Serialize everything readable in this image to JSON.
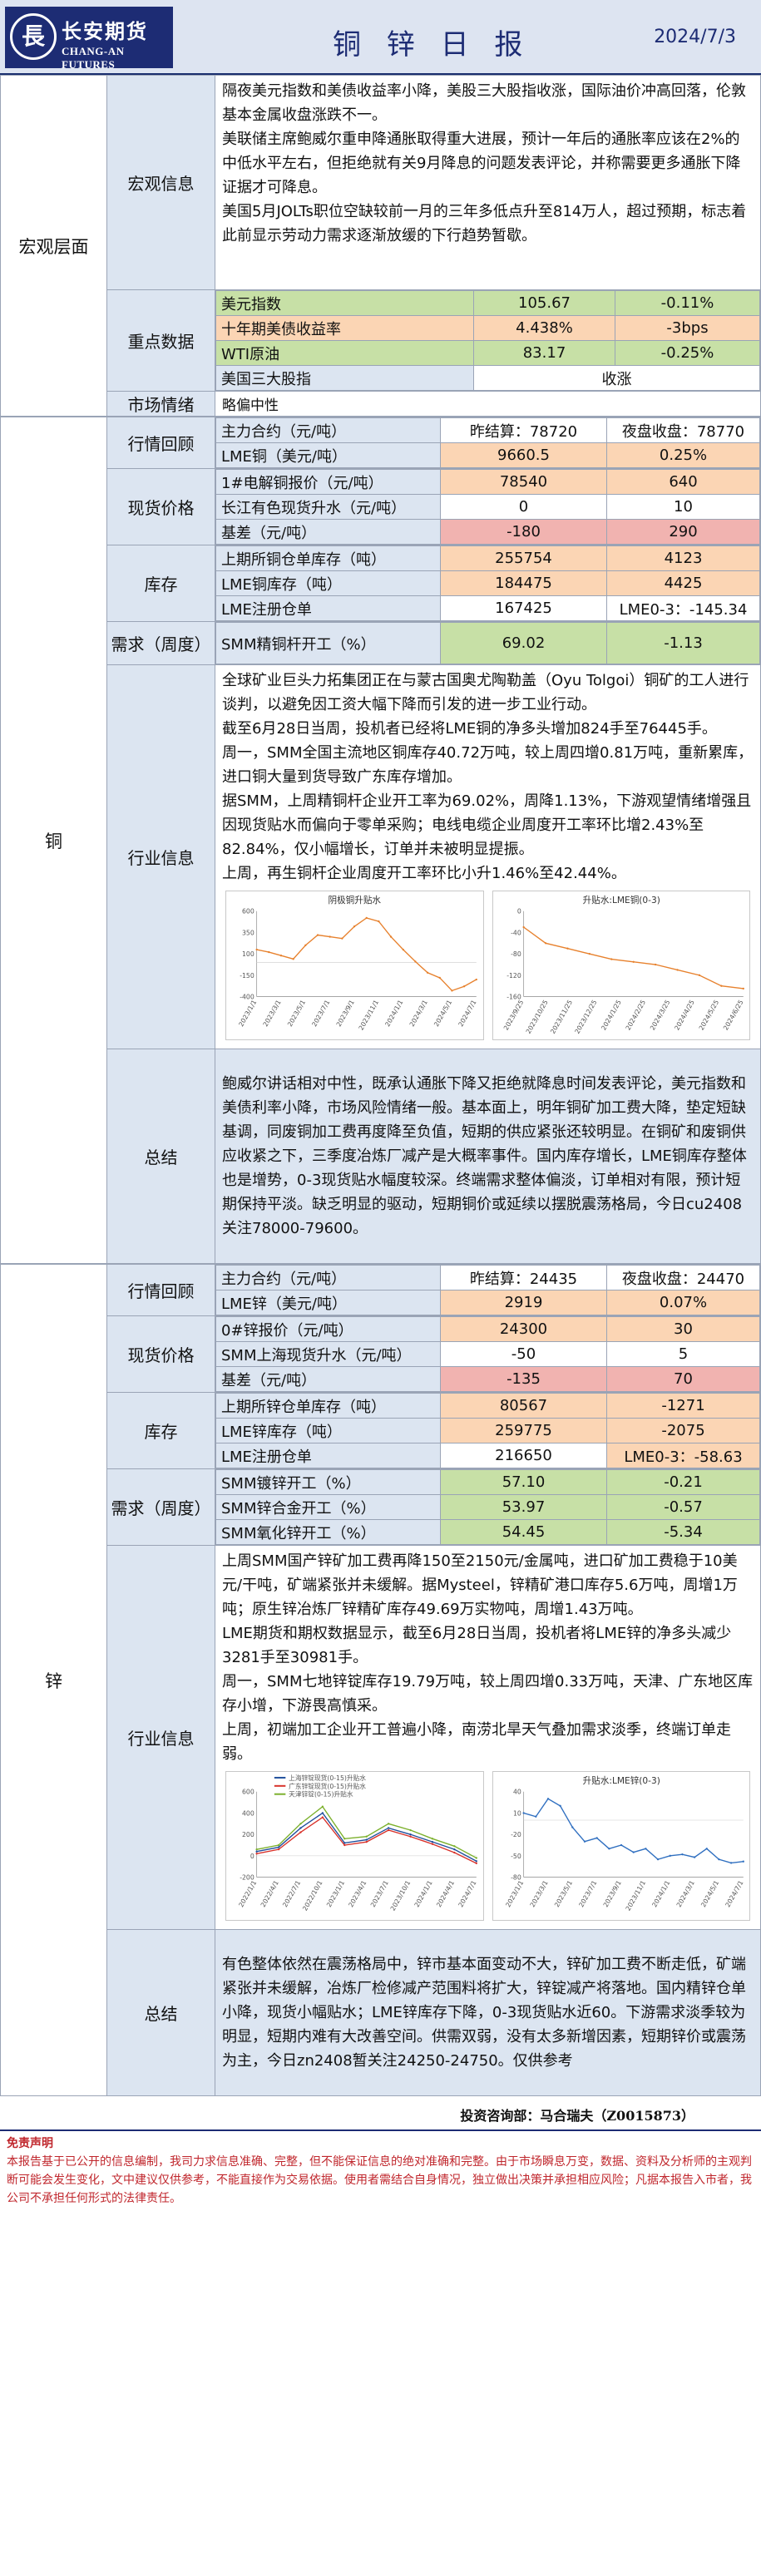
{
  "header": {
    "logo_cn": "长安期货",
    "logo_en": "CHANG-AN FUTURES",
    "title": "铜 锌 日 报",
    "date": "2024/7/3"
  },
  "macro": {
    "section": "宏观层面",
    "info_label": "宏观信息",
    "info_paragraphs": [
      "隔夜美元指数和美债收益率小降，美股三大股指收涨，国际油价冲高回落，伦敦基本金属收盘涨跌不一。",
      "美联储主席鲍威尔重申降通胀取得重大进展，预计一年后的通胀率应该在2%的中低水平左右，但拒绝就有关9月降息的问题发表评论，并称需要更多通胀下降证据才可降息。",
      "美国5月JOLTs职位空缺较前一月的三年多低点升至814万人，超过预期，标志着此前显示劳动力需求逐渐放缓的下行趋势暂歇。"
    ],
    "key_label": "重点数据",
    "key_rows": [
      {
        "name": "美元指数",
        "value": "105.67",
        "change": "-0.11%"
      },
      {
        "name": "十年期美债收益率",
        "value": "4.438%",
        "change": "-3bps"
      },
      {
        "name": "WTI原油",
        "value": "83.17",
        "change": "-0.25%"
      },
      {
        "name": "美国三大股指",
        "value": "",
        "change": "收涨"
      }
    ],
    "mood_label": "市场情绪",
    "mood_value": "略偏中性"
  },
  "copper": {
    "section": "铜",
    "review_label": "行情回顾",
    "main_contract": "主力合约（元/吨）",
    "settle": "昨结算：78720",
    "night": "夜盘收盘：78770",
    "lme_name": "LME铜（美元/吨）",
    "lme_value": "9660.5",
    "lme_change": "0.25%",
    "spot_label": "现货价格",
    "spot_rows": [
      {
        "name": "1#电解铜报价（元/吨）",
        "value": "78540",
        "change": "640"
      },
      {
        "name": "长江有色现货升水（元/吨）",
        "value": "0",
        "change": "10"
      },
      {
        "name": "基差（元/吨）",
        "value": "-180",
        "change": "290"
      }
    ],
    "inv_label": "库存",
    "inv_rows": [
      {
        "name": "上期所铜仓单库存（吨）",
        "value": "255754",
        "change": "4123"
      },
      {
        "name": "LME铜库存（吨）",
        "value": "184475",
        "change": "4425"
      },
      {
        "name": "LME注册仓单",
        "value": "167425",
        "change": "LME0-3：-145.34"
      }
    ],
    "demand_label": "需求（周度）",
    "demand_rows": [
      {
        "name": "SMM精铜杆开工（%）",
        "value": "69.02",
        "change": "-1.13"
      }
    ],
    "industry_label": "行业信息",
    "industry_paragraphs": [
      "全球矿业巨头力拓集团正在与蒙古国奥尤陶勒盖（Oyu Tolgoi）铜矿的工人进行谈判，以避免因工资大幅下降而引发的进一步工业行动。",
      "截至6月28日当周，投机者已经将LME铜的净多头增加824手至76445手。",
      "周一，SMM全国主流地区铜库存40.72万吨，较上周四增0.81万吨，重新累库，进口铜大量到货导致广东库存增加。",
      "据SMM，上周精铜杆企业开工率为69.02%，周降1.13%，下游观望情绪增强且因现货贴水而偏向于零单采购；电线电缆企业周度开工率环比增2.43%至82.84%，仅小幅增长，订单并未被明显提振。",
      "上周，再生铜杆企业周度开工率环比小升1.46%至42.44%。"
    ],
    "chart_data": [
      {
        "type": "line",
        "title": "阴极铜升贴水",
        "x": [
          "2023/1/1",
          "2023/2/1",
          "2023/3/1",
          "2023/4/1",
          "2023/5/1",
          "2023/6/1",
          "2023/7/1",
          "2023/8/1",
          "2023/9/1",
          "2023/10/1",
          "2023/11/1",
          "2023/12/1",
          "2024/1/1",
          "2024/2/1",
          "2024/3/1",
          "2024/4/1",
          "2024/5/1",
          "2024/6/1",
          "2024/7/1"
        ],
        "x_ticks": [
          "2023/1/1",
          "2023/3/1",
          "2023/5/1",
          "2023/7/1",
          "2023/9/1",
          "2023/11/1",
          "2024/1/1",
          "2024/3/1",
          "2024/5/1",
          "2024/7/1"
        ],
        "values": [
          150,
          120,
          80,
          40,
          200,
          320,
          300,
          280,
          420,
          520,
          480,
          300,
          150,
          10,
          -120,
          -180,
          -330,
          -280,
          -200
        ],
        "ylim": [
          -400,
          600
        ],
        "color": "#e7812d"
      },
      {
        "type": "line",
        "title": "升贴水:LME铜(0-3)",
        "x": [
          "2023/9/1",
          "2023/10/1",
          "2023/11/1",
          "2023/12/1",
          "2024/1/1",
          "2024/2/1",
          "2024/3/1",
          "2024/4/1",
          "2024/5/1",
          "2024/6/1",
          "2024/7/1"
        ],
        "x_ticks": [
          "2023/9/25",
          "2023/10/25",
          "2023/11/25",
          "2023/12/25",
          "2024/1/25",
          "2024/2/25",
          "2024/3/25",
          "2024/4/25",
          "2024/5/25",
          "2024/6/25"
        ],
        "values": [
          -30,
          -60,
          -70,
          -80,
          -90,
          -95,
          -100,
          -110,
          -120,
          -140,
          -145
        ],
        "ylim": [
          -160,
          0
        ],
        "color": "#e7812d"
      }
    ],
    "summary_label": "总结",
    "summary": "鲍威尔讲话相对中性，既承认通胀下降又拒绝就降息时间发表评论，美元指数和美债利率小降，市场风险情绪一般。基本面上，明年铜矿加工费大降，垫定短缺基调，同废铜加工费再度降至负值，短期的供应紧张还较明显。在铜矿和废铜供应收紧之下，三季度冶炼厂减产是大概率事件。国内库存增长，LME铜库存整体也是增势，0-3现货贴水幅度较深。终端需求整体偏淡，订单相对有限，预计短期保持平淡。缺乏明显的驱动，短期铜价或延续以摆脱震荡格局，今日cu2408关注78000-79600。"
  },
  "zinc": {
    "section": "锌",
    "review_label": "行情回顾",
    "main_contract": "主力合约（元/吨）",
    "settle": "昨结算：24435",
    "night": "夜盘收盘：24470",
    "lme_name": "LME锌（美元/吨）",
    "lme_value": "2919",
    "lme_change": "0.07%",
    "spot_label": "现货价格",
    "spot_rows": [
      {
        "name": "0#锌报价（元/吨）",
        "value": "24300",
        "change": "30"
      },
      {
        "name": "SMM上海现货升水（元/吨）",
        "value": "-50",
        "change": "5"
      },
      {
        "name": "基差（元/吨）",
        "value": "-135",
        "change": "70"
      }
    ],
    "inv_label": "库存",
    "inv_rows": [
      {
        "name": "上期所锌仓单库存（吨）",
        "value": "80567",
        "change": "-1271"
      },
      {
        "name": "LME锌库存（吨）",
        "value": "259775",
        "change": "-2075"
      },
      {
        "name": "LME注册仓单",
        "value": "216650",
        "change": "LME0-3：-58.63"
      }
    ],
    "demand_label": "需求（周度）",
    "demand_rows": [
      {
        "name": "SMM镀锌开工（%）",
        "value": "57.10",
        "change": "-0.21"
      },
      {
        "name": "SMM锌合金开工（%）",
        "value": "53.97",
        "change": "-0.57"
      },
      {
        "name": "SMM氧化锌开工（%）",
        "value": "54.45",
        "change": "-5.34"
      }
    ],
    "industry_label": "行业信息",
    "industry_paragraphs": [
      "上周SMM国产锌矿加工费再降150至2150元/金属吨，进口矿加工费稳于10美元/干吨，矿端紧张并未缓解。据Mysteel，锌精矿港口库存5.6万吨，周增1万吨；原生锌冶炼厂锌精矿库存49.69万实物吨，周增1.43万吨。",
      "LME期货和期权数据显示，截至6月28日当周，投机者将LME锌的净多头减少3281手至30981手。",
      "周一，SMM七地锌锭库存19.79万吨，较上周四增0.33万吨，天津、广东地区库存小增，下游畏高慎采。",
      "上周，初端加工企业开工普遍小降，南涝北旱天气叠加需求淡季，终端订单走弱。"
    ],
    "chart_data": [
      {
        "type": "line",
        "title": "",
        "legend": [
          "上海锌锭现货(0-15)升贴水",
          "广东锌锭现货(0-15)升贴水",
          "天津锌锭(0-15)升贴水"
        ],
        "x": [
          "2022/1/1",
          "2022/4/1",
          "2022/7/1",
          "2022/10/1",
          "2023/1/1",
          "2023/4/1",
          "2023/7/1",
          "2023/10/1",
          "2024/1/1",
          "2024/4/1",
          "2024/7/1"
        ],
        "x_ticks": [
          "2022/1/1",
          "2022/4/1",
          "2022/7/1",
          "2022/10/1",
          "2023/1/1",
          "2023/4/1",
          "2023/7/1",
          "2023/10/1",
          "2024/1/1",
          "2024/4/1",
          "2024/7/1"
        ],
        "series": [
          {
            "values": [
              40,
              80,
              260,
              400,
              120,
              150,
              260,
              200,
              130,
              60,
              -50
            ],
            "color": "#1f4e9c"
          },
          {
            "values": [
              20,
              60,
              220,
              360,
              100,
              130,
              240,
              180,
              110,
              30,
              -70
            ],
            "color": "#d8312a"
          },
          {
            "values": [
              60,
              100,
              300,
              460,
              160,
              180,
              300,
              240,
              160,
              90,
              -20
            ],
            "color": "#7bb02b"
          }
        ],
        "ylim": [
          -200,
          600
        ]
      },
      {
        "type": "line",
        "title": "升贴水:LME锌(0-3)",
        "x": [
          "2023/1/1",
          "2023/2/1",
          "2023/3/1",
          "2023/4/1",
          "2023/5/1",
          "2023/6/1",
          "2023/7/1",
          "2023/8/1",
          "2023/9/1",
          "2023/10/1",
          "2023/11/1",
          "2023/12/1",
          "2024/1/1",
          "2024/2/1",
          "2024/3/1",
          "2024/4/1",
          "2024/5/1",
          "2024/6/1",
          "2024/7/1"
        ],
        "x_ticks": [
          "2023/1/1",
          "2023/3/1",
          "2023/5/1",
          "2023/7/1",
          "2023/9/1",
          "2023/11/1",
          "2024/1/1",
          "2024/3/1",
          "2024/5/1",
          "2024/7/1"
        ],
        "values": [
          10,
          5,
          30,
          20,
          -10,
          -30,
          -25,
          -40,
          -35,
          -45,
          -40,
          -55,
          -50,
          -48,
          -52,
          -40,
          -55,
          -60,
          -58
        ],
        "ylim": [
          -80,
          40
        ],
        "color": "#2f6fc0"
      }
    ],
    "summary_label": "总结",
    "summary": "有色整体依然在震荡格局中，锌市基本面变动不大，锌矿加工费不断走低，矿端紧张并未缓解，冶炼厂检修减产范围料将扩大，锌锭减产将落地。国内精锌仓单小降，现货小幅贴水；LME锌库存下降，0-3现货贴水近60。下游需求淡季较为明显，短期内难有大改善空间。供需双弱，没有太多新增因素，短期锌价或震荡为主，今日zn2408暂关注24250-24750。仅供参考"
  },
  "footer": {
    "analyst": "投资咨询部：马合瑞夫（Z0015873）",
    "disclaimer_title": "免责声明",
    "disclaimer": "本报告基于已公开的信息编制，我司力求信息准确、完整，但不能保证信息的绝对准确和完整。由于市场瞬息万变，数据、资料及分析师的主观判断可能会发生变化，文中建议仅供参考，不能直接作为交易依据。使用者需结合自身情况，独立做出决策并承担相应风险；凡据本报告入市者，我公司不承担任何形式的法律责任。"
  }
}
